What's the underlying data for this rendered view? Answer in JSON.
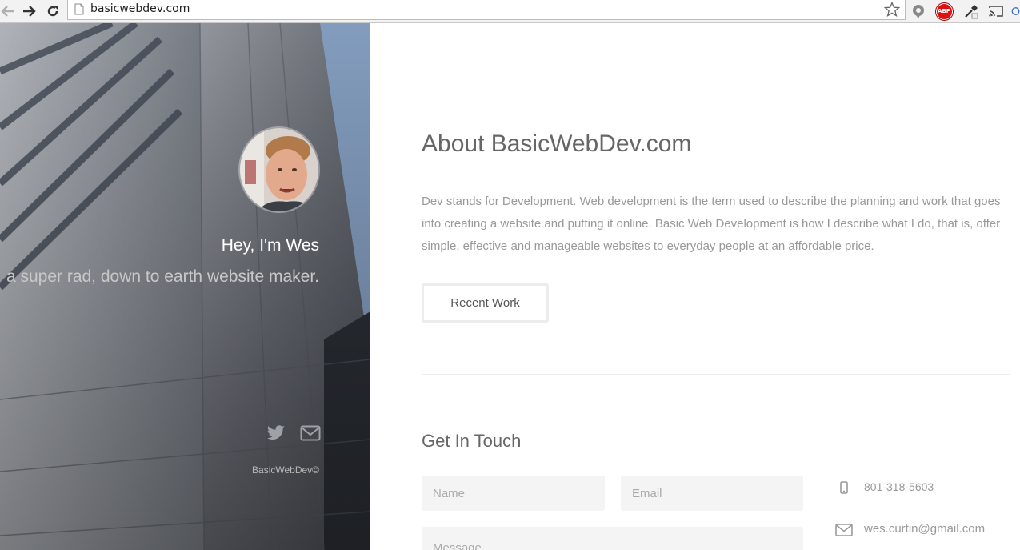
{
  "browser": {
    "url": "basicwebdev.com"
  },
  "hero": {
    "title": "Hey, I'm Wes",
    "tagline": "a super rad, down to earth website maker.",
    "copyright": "BasicWebDev©"
  },
  "about": {
    "title": "About BasicWebDev.com",
    "body": "Dev stands for Development. Web development is the term used to describe the planning and work that goes into creating a website and putting it online. Basic Web Development is how I describe what I do, that is, offer simple, effective and manageable websites to everyday people at an affordable price.",
    "button_label": "Recent Work"
  },
  "contact": {
    "title": "Get In Touch",
    "name_placeholder": "Name",
    "email_placeholder": "Email",
    "message_placeholder": "Message",
    "phone": "801-318-5603",
    "email": "wes.curtin@gmail.com"
  },
  "icons": {
    "back": "arrow-left-icon",
    "forward": "arrow-right-icon",
    "reload": "reload-icon",
    "page": "page-icon",
    "bookmark": "star-icon",
    "twitter": "twitter-icon",
    "mail": "envelope-icon",
    "phone": "phone-icon"
  },
  "colors": {
    "heading": "#666666",
    "body_text": "#999999",
    "field_bg": "#f4f4f4",
    "abp_red": "#dd1111"
  }
}
